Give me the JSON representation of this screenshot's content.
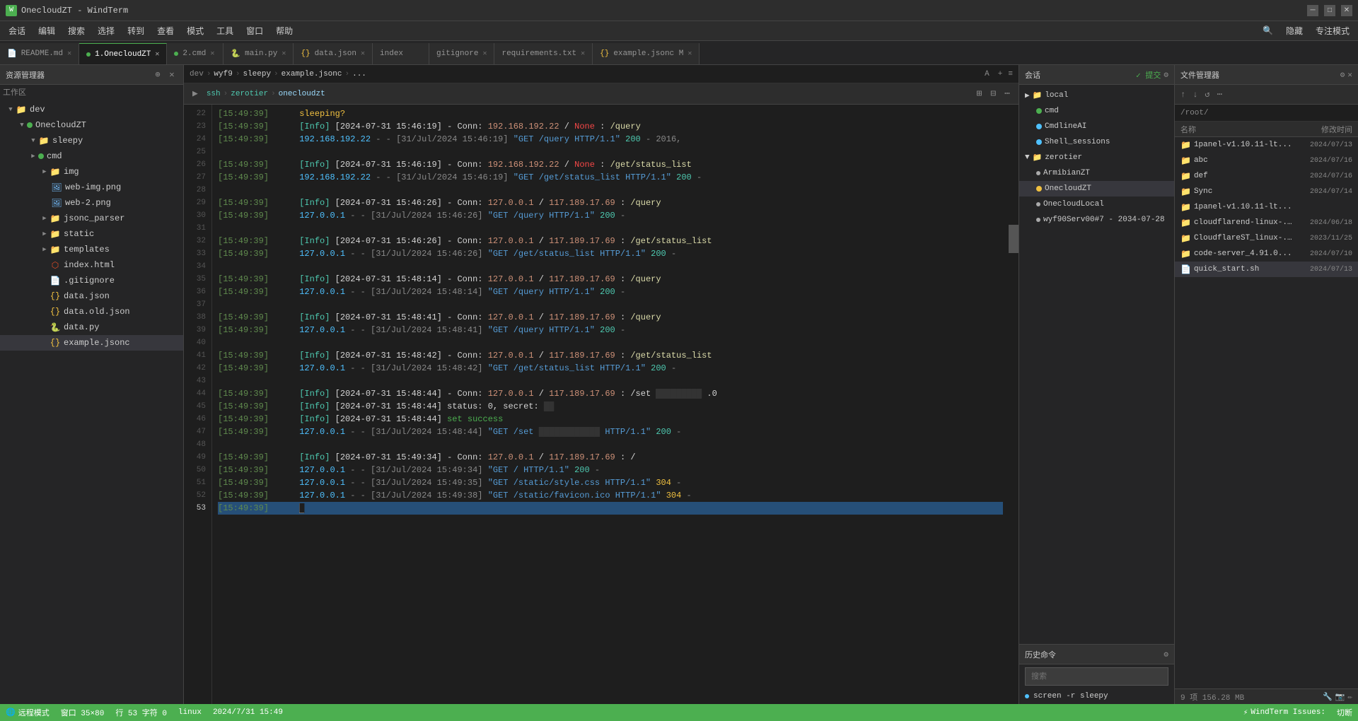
{
  "titleBar": {
    "title": "OnecloudZT - WindTerm",
    "iconText": "WT",
    "minBtn": "─",
    "maxBtn": "□",
    "closeBtn": "✕"
  },
  "menuBar": {
    "items": [
      "会话",
      "编辑",
      "搜索",
      "选择",
      "转到",
      "查看",
      "模式",
      "工具",
      "窗口",
      "帮助"
    ]
  },
  "tabs": [
    {
      "label": "README.md",
      "dot": "none",
      "active": false,
      "icon": "md"
    },
    {
      "label": "1.OnecloudZT",
      "dot": "green",
      "active": true,
      "icon": "term"
    },
    {
      "label": "2.cmd",
      "dot": "green",
      "active": false,
      "icon": "term"
    },
    {
      "label": "main.py",
      "dot": "none",
      "active": false,
      "icon": "py"
    },
    {
      "label": "data.json",
      "dot": "none",
      "active": false,
      "icon": "json"
    },
    {
      "label": "index",
      "dot": "none",
      "active": false,
      "icon": "file"
    },
    {
      "label": "gitignore",
      "dot": "none",
      "active": false,
      "icon": "file"
    },
    {
      "label": "requirements.txt",
      "dot": "none",
      "active": false,
      "icon": "file"
    },
    {
      "label": "example.jsonc",
      "dot": "yellow",
      "active": false,
      "icon": "json"
    }
  ],
  "breadcrumb": {
    "items": [
      "dev",
      "wyf9",
      "sleepy",
      "example.jsonc",
      "..."
    ]
  },
  "terminalPath": {
    "items": [
      "ssh",
      "zerotier",
      "onecloudzt"
    ]
  },
  "lineNumbers": [
    22,
    23,
    24,
    25,
    26,
    27,
    28,
    29,
    30,
    31,
    32,
    33,
    34,
    35,
    36,
    37,
    38,
    39,
    40,
    41,
    42,
    43,
    44,
    45,
    46,
    47,
    48,
    49,
    50,
    51,
    52,
    53
  ],
  "terminalLines": [
    {
      "ts": "[15:49:39]",
      "num": 22,
      "text": "sleeping?",
      "type": "normal"
    },
    {
      "ts": "[15:49:39]",
      "num": 23,
      "text": "[Info] [2024-07-31 15:46:19] - Conn: 192.168.192.22 / None : /query",
      "type": "info"
    },
    {
      "ts": "[15:49:39]",
      "num": 24,
      "text": "192.168.192.22 - - [31/Jul/2024 15:46:19] \"GET /query HTTP/1.1\" 200 - 2016,",
      "type": "access"
    },
    {
      "ts": "[15:49:39]",
      "num": 25,
      "text": "",
      "type": "empty"
    },
    {
      "ts": "[15:49:39]",
      "num": 26,
      "text": "[Info] [2024-07-31 15:46:19] - Conn: 192.168.192.22 / None : /get/status_list",
      "type": "info"
    },
    {
      "ts": "[15:49:39]",
      "num": 27,
      "text": "192.168.192.22 - - [31/Jul/2024 15:46:19] \"GET /get/status_list HTTP/1.1\" 200 -",
      "type": "access"
    },
    {
      "ts": "[15:49:39]",
      "num": 28,
      "text": "",
      "type": "empty"
    },
    {
      "ts": "[15:49:39]",
      "num": 29,
      "text": "[Info] [2024-07-31 15:46:26] - Conn: 127.0.0.1 / 117.189.17.69 : /query",
      "type": "info"
    },
    {
      "ts": "[15:49:39]",
      "num": 30,
      "text": "127.0.0.1 - - [31/Jul/2024 15:46:26] \"GET /query HTTP/1.1\" 200 -",
      "type": "access"
    },
    {
      "ts": "[15:49:39]",
      "num": 31,
      "text": "",
      "type": "empty"
    },
    {
      "ts": "[15:49:39]",
      "num": 32,
      "text": "[Info] [2024-07-31 15:46:26] - Conn: 127.0.0.1 / 117.189.17.69 : /get/status_list",
      "type": "info"
    },
    {
      "ts": "[15:49:39]",
      "num": 33,
      "text": "127.0.0.1 - - [31/Jul/2024 15:46:26] \"GET /get/status_list HTTP/1.1\" 200 -",
      "type": "access"
    },
    {
      "ts": "[15:49:39]",
      "num": 34,
      "text": "",
      "type": "empty"
    },
    {
      "ts": "[15:49:39]",
      "num": 35,
      "text": "[Info] [2024-07-31 15:48:14] - Conn: 127.0.0.1 / 117.189.17.69 : /query",
      "type": "info"
    },
    {
      "ts": "[15:49:39]",
      "num": 36,
      "text": "127.0.0.1 - - [31/Jul/2024 15:48:14] \"GET /query HTTP/1.1\" 200 -",
      "type": "access"
    },
    {
      "ts": "[15:49:39]",
      "num": 37,
      "text": "",
      "type": "empty"
    },
    {
      "ts": "[15:49:39]",
      "num": 38,
      "text": "[Info] [2024-07-31 15:48:41] - Conn: 127.0.0.1 / 117.189.17.69 : /query",
      "type": "info"
    },
    {
      "ts": "[15:49:39]",
      "num": 39,
      "text": "127.0.0.1 - - [31/Jul/2024 15:48:41] \"GET /query HTTP/1.1\" 200 -",
      "type": "access"
    },
    {
      "ts": "[15:49:39]",
      "num": 40,
      "text": "",
      "type": "empty"
    },
    {
      "ts": "[15:49:39]",
      "num": 41,
      "text": "[Info] [2024-07-31 15:48:42] - Conn: 127.0.0.1 / 117.189.17.69 : /get/status_list",
      "type": "info"
    },
    {
      "ts": "[15:49:39]",
      "num": 42,
      "text": "127.0.0.1 - - [31/Jul/2024 15:48:42] \"GET /get/status_list HTTP/1.1\" 200 -",
      "type": "access"
    },
    {
      "ts": "[15:49:39]",
      "num": 43,
      "text": "",
      "type": "empty"
    },
    {
      "ts": "[15:49:39]",
      "num": 44,
      "text": "[Info] [2024-07-31 15:48:44] - Conn: 127.0.0.1 / 117.189.17.69 : /set█████████ .0",
      "type": "info"
    },
    {
      "ts": "[15:49:39]",
      "num": 45,
      "text": "[Info] [2024-07-31 15:48:44] status: 0, secret: ██",
      "type": "info2"
    },
    {
      "ts": "[15:49:39]",
      "num": 46,
      "text": "[Info] [2024-07-31 15:48:44] set success",
      "type": "success"
    },
    {
      "ts": "[15:49:39]",
      "num": 47,
      "text": "127.0.0.1 - - [31/Jul/2024 15:48:44] \"GET /set ████████████ HTTP/1.1\" 200 -",
      "type": "access"
    },
    {
      "ts": "[15:49:39]",
      "num": 48,
      "text": "",
      "type": "empty"
    },
    {
      "ts": "[15:49:39]",
      "num": 49,
      "text": "[Info] [2024-07-31 15:49:34] - Conn: 127.0.0.1 / 117.189.17.69 : /",
      "type": "info"
    },
    {
      "ts": "[15:49:39]",
      "num": 50,
      "text": "127.0.0.1 - - [31/Jul/2024 15:49:34] \"GET / HTTP/1.1\" 200 -",
      "type": "access"
    },
    {
      "ts": "[15:49:39]",
      "num": 51,
      "text": "127.0.0.1 - - [31/Jul/2024 15:49:35] \"GET /static/style.css HTTP/1.1\" 304 -",
      "type": "access"
    },
    {
      "ts": "[15:49:39]",
      "num": 52,
      "text": "127.0.0.1 - - [31/Jul/2024 15:49:38] \"GET /static/favicon.ico HTTP/1.1\" 304 -",
      "type": "access"
    },
    {
      "ts": "[15:49:39]",
      "num": 53,
      "text": "█",
      "type": "cursor",
      "current": true
    }
  ],
  "rightPanel": {
    "header": "会话",
    "submitBtn": "提交",
    "sections": {
      "local": {
        "label": "local",
        "items": [
          "cmd",
          "CmdlineAI",
          "Shell_sessions"
        ]
      },
      "zerotier": {
        "label": "zerotier",
        "items": [
          {
            "label": "ArmibianZT",
            "color": "yellow"
          },
          {
            "label": "OnecloudZT",
            "color": "yellow"
          },
          {
            "label": "OnecloudLocal",
            "color": "yellow"
          },
          {
            "label": "wyf90Serv00#7 - 2034-07-28",
            "color": "yellow"
          }
        ]
      }
    },
    "history": {
      "header": "历史命令",
      "search_placeholder": "搜索",
      "items": [
        "screen -r sleepy"
      ]
    }
  },
  "fileManager": {
    "header": "文件管理器",
    "currentPath": "/root/",
    "toolbar": {
      "items": [
        "↑",
        "↓",
        "↺",
        "⋯"
      ]
    },
    "columns": {
      "name": "名称",
      "modified": "修改时间"
    },
    "files": [
      {
        "name": "1panel-v1.10.11-lt...",
        "date": "2024/07/13",
        "type": "folder",
        "active": false
      },
      {
        "name": "abc",
        "date": "2024/07/16",
        "type": "folder",
        "active": false
      },
      {
        "name": "def",
        "date": "2024/07/16",
        "type": "folder",
        "active": false
      },
      {
        "name": "Sync",
        "date": "2024/07/14",
        "type": "folder",
        "active": false
      },
      {
        "name": "1panel-v1.10.11-lt...",
        "date": "",
        "type": "folder",
        "active": false
      },
      {
        "name": "cloudflarend-linux-...",
        "date": "2024/06/18",
        "type": "folder",
        "active": false
      },
      {
        "name": "CloudflareST_linux-...",
        "date": "2023/11/25",
        "type": "folder",
        "active": false
      },
      {
        "name": "code-server_4.91.0...",
        "date": "2024/07/10",
        "type": "folder",
        "active": false
      },
      {
        "name": "quick_start.sh",
        "date": "2024/07/13",
        "type": "file",
        "active": true
      }
    ],
    "status": {
      "fileCount": "9 项 156.28 MB"
    },
    "bottomIcons": [
      "🔧",
      "📷",
      "✏️"
    ]
  },
  "resourceExplorer": {
    "header": "资源管理器",
    "workspaceLabel": "工作区",
    "tree": {
      "dev": {
        "label": "dev",
        "expanded": true,
        "children": {
          "OnecloudZT": {
            "label": "OnecloudZT",
            "expanded": true,
            "children": {
              "sleepy": {
                "label": "sleepy",
                "expanded": true,
                "children": {
                  "img": {
                    "label": "img",
                    "expanded": false
                  },
                  "web-img.png": {
                    "label": "web-img.png",
                    "type": "file"
                  },
                  "web-2.png": {
                    "label": "web-2.png",
                    "type": "file"
                  },
                  "jsonc_parser": {
                    "label": "jsonc_parser",
                    "type": "folder"
                  },
                  "static": {
                    "label": "static",
                    "type": "folder"
                  },
                  "templates": {
                    "label": "templates",
                    "type": "folder"
                  },
                  "index.html": {
                    "label": "index.html",
                    "type": "file"
                  },
                  ".gitignore": {
                    "label": ".gitignore",
                    "type": "file"
                  },
                  "data.json": {
                    "label": "data.json",
                    "type": "file"
                  },
                  "data.old.json": {
                    "label": "data.old.json",
                    "type": "file"
                  },
                  "data.py": {
                    "label": "data.py",
                    "type": "file"
                  },
                  "example.jsonc": {
                    "label": "example.jsonc",
                    "type": "file",
                    "active": true
                  }
                }
              },
              "cmd": {
                "label": "cmd",
                "type": "folder"
              }
            }
          }
        }
      }
    }
  },
  "statusBar": {
    "mode": "远程模式",
    "window": "窗口 35×80",
    "position": "行 53 字符 0",
    "os": "linux",
    "datetime": "2024/7/31 15:49",
    "brand": "WindTerm Issues:",
    "rightText": "切断"
  }
}
